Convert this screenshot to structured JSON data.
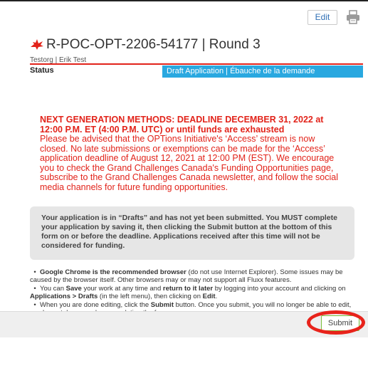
{
  "header": {
    "edit_label": "Edit",
    "print_icon": "printer-icon"
  },
  "application": {
    "leaf_icon": "red-maple-leaf-icon",
    "title": "R-POC-OPT-2206-54177 | Round 3",
    "org": "Testorg | Erik Test",
    "status_label": "Status",
    "status_value": "Draft Application | Ébauche de la demande",
    "status_color": "#29a8e0"
  },
  "notice": {
    "heading": "NEXT GENERATION METHODS: DEADLINE  DECEMBER 31, 2022 at 12:00 P.M. ET (4:00 P.M. UTC) or until funds are exhausted",
    "body": "Please be advised that the OPTions Initiative's ‘Access’ stream is now closed. No late submissions or exemptions can be made for the ‘Access’ application deadline of August 12, 2021 at 12:00 PM (EST). We encourage you to check the Grand Challenges Canada's Funding Opportunities page, subscribe to the Grand Challenges Canada newsletter, and follow the social media channels for future funding opportunities.",
    "color": "#e2231a"
  },
  "draft_notice": "Your application is in “Drafts” and has not yet been submitted. You MUST complete your application by saving it, then clicking the Submit button at the bottom of this form on or before the deadline. Applications received after this time will not be considered for funding.",
  "instructions": [
    {
      "parts": [
        {
          "t": "Google Chrome is the recommended browser",
          "b": true
        },
        {
          "t": " (do not use Internet Explorer).  Some issues may be caused by the browser itself. Other browsers may or may not support all Fluxx features.",
          "b": false
        }
      ]
    },
    {
      "parts": [
        {
          "t": "You can ",
          "b": false
        },
        {
          "t": "Save",
          "b": true
        },
        {
          "t": " your work at any time and ",
          "b": false
        },
        {
          "t": "return to it later",
          "b": true
        },
        {
          "t": " by logging into your account and clicking on ",
          "b": false
        },
        {
          "t": "Applications > Drafts",
          "b": true
        },
        {
          "t": " (in the left menu), then clicking on ",
          "b": false
        },
        {
          "t": "Edit",
          "b": true
        },
        {
          "t": ".",
          "b": false
        }
      ]
    },
    {
      "parts": [
        {
          "t": "When you are done editing, click the ",
          "b": false
        },
        {
          "t": "Submit",
          "b": true
        },
        {
          "t": " button. Once you submit, you will no longer be able to edit, so please take care when completing the form.",
          "b": false
        }
      ]
    }
  ],
  "footer": {
    "submit_label": "Submit",
    "highlight_color": "#e8231b"
  }
}
